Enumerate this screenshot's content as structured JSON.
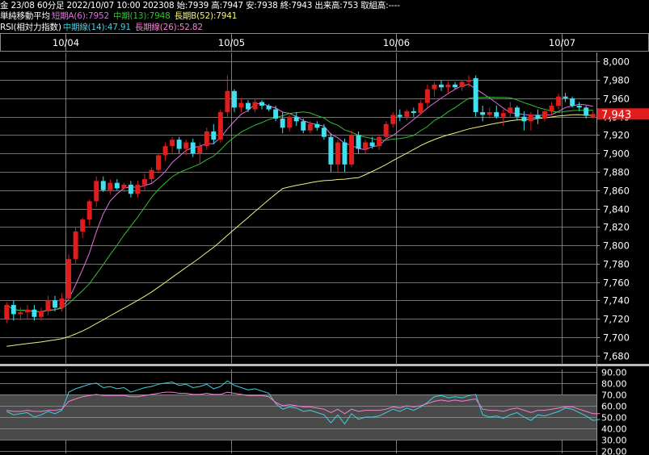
{
  "header": {
    "info": "金 23/08 60分足 2022/10/07 10:00 202308 始:7939 高:7947 安:7938 終:7943 出来高:753 取組高:----",
    "ma_title": "単純移動平均",
    "ma_short": "短期A(6):7952",
    "ma_mid": "中期(13):7948",
    "ma_long": "長期B(52):7941",
    "rsi_title": "RSI(相対力指数)",
    "rsi_mid": "中期線(14):47.91",
    "rsi_long": "長期線(26):52.82"
  },
  "colors": {
    "up": "#e01c1c",
    "down": "#40e0f0",
    "ma_short": "#e070e0",
    "ma_mid": "#30c030",
    "ma_long": "#f0f080",
    "rsi_mid": "#40d0e0",
    "rsi_long": "#f080d0",
    "price_tag": "#e01c1c"
  },
  "chart_data": [
    {
      "type": "candlestick",
      "title": "",
      "x_ticks": [
        "10/04",
        "10/05",
        "10/06",
        "10/07"
      ],
      "y_ticks": [
        "8,000",
        "7,980",
        "7,960",
        "7,940",
        "7,920",
        "7,900",
        "7,880",
        "7,860",
        "7,840",
        "7,820",
        "7,800",
        "7,780",
        "7,760",
        "7,740",
        "7,720",
        "7,700",
        "7,680"
      ],
      "ylim": [
        7670,
        8010
      ],
      "current_price_label": "7,943",
      "current_price": 7943,
      "grid": true,
      "candles": [
        {
          "o": 7720,
          "h": 7738,
          "l": 7715,
          "c": 7735
        },
        {
          "o": 7735,
          "h": 7740,
          "l": 7718,
          "c": 7725
        },
        {
          "o": 7725,
          "h": 7732,
          "l": 7718,
          "c": 7727
        },
        {
          "o": 7727,
          "h": 7735,
          "l": 7720,
          "c": 7730
        },
        {
          "o": 7730,
          "h": 7735,
          "l": 7718,
          "c": 7722
        },
        {
          "o": 7722,
          "h": 7732,
          "l": 7718,
          "c": 7728
        },
        {
          "o": 7728,
          "h": 7745,
          "l": 7724,
          "c": 7740
        },
        {
          "o": 7740,
          "h": 7745,
          "l": 7728,
          "c": 7732
        },
        {
          "o": 7732,
          "h": 7748,
          "l": 7728,
          "c": 7742
        },
        {
          "o": 7742,
          "h": 7790,
          "l": 7738,
          "c": 7785
        },
        {
          "o": 7785,
          "h": 7820,
          "l": 7780,
          "c": 7815
        },
        {
          "o": 7815,
          "h": 7830,
          "l": 7808,
          "c": 7828
        },
        {
          "o": 7828,
          "h": 7850,
          "l": 7822,
          "c": 7848
        },
        {
          "o": 7848,
          "h": 7875,
          "l": 7842,
          "c": 7870
        },
        {
          "o": 7870,
          "h": 7875,
          "l": 7858,
          "c": 7860
        },
        {
          "o": 7860,
          "h": 7872,
          "l": 7855,
          "c": 7868
        },
        {
          "o": 7868,
          "h": 7872,
          "l": 7860,
          "c": 7862
        },
        {
          "o": 7862,
          "h": 7868,
          "l": 7858,
          "c": 7866
        },
        {
          "o": 7866,
          "h": 7870,
          "l": 7852,
          "c": 7856
        },
        {
          "o": 7856,
          "h": 7870,
          "l": 7852,
          "c": 7866
        },
        {
          "o": 7866,
          "h": 7878,
          "l": 7860,
          "c": 7872
        },
        {
          "o": 7872,
          "h": 7885,
          "l": 7868,
          "c": 7882
        },
        {
          "o": 7882,
          "h": 7900,
          "l": 7878,
          "c": 7898
        },
        {
          "o": 7898,
          "h": 7912,
          "l": 7892,
          "c": 7908
        },
        {
          "o": 7908,
          "h": 7918,
          "l": 7900,
          "c": 7915
        },
        {
          "o": 7915,
          "h": 7918,
          "l": 7900,
          "c": 7905
        },
        {
          "o": 7905,
          "h": 7915,
          "l": 7898,
          "c": 7912
        },
        {
          "o": 7912,
          "h": 7916,
          "l": 7896,
          "c": 7900
        },
        {
          "o": 7900,
          "h": 7912,
          "l": 7888,
          "c": 7908
        },
        {
          "o": 7908,
          "h": 7928,
          "l": 7904,
          "c": 7924
        },
        {
          "o": 7924,
          "h": 7932,
          "l": 7910,
          "c": 7915
        },
        {
          "o": 7915,
          "h": 7948,
          "l": 7912,
          "c": 7945
        },
        {
          "o": 7945,
          "h": 7985,
          "l": 7940,
          "c": 7968
        },
        {
          "o": 7968,
          "h": 7970,
          "l": 7945,
          "c": 7950
        },
        {
          "o": 7950,
          "h": 7960,
          "l": 7945,
          "c": 7955
        },
        {
          "o": 7955,
          "h": 7958,
          "l": 7945,
          "c": 7948
        },
        {
          "o": 7948,
          "h": 7960,
          "l": 7945,
          "c": 7956
        },
        {
          "o": 7956,
          "h": 7958,
          "l": 7948,
          "c": 7952
        },
        {
          "o": 7952,
          "h": 7954,
          "l": 7946,
          "c": 7948
        },
        {
          "o": 7948,
          "h": 7952,
          "l": 7935,
          "c": 7938
        },
        {
          "o": 7938,
          "h": 7945,
          "l": 7922,
          "c": 7928
        },
        {
          "o": 7928,
          "h": 7942,
          "l": 7924,
          "c": 7940
        },
        {
          "o": 7940,
          "h": 7945,
          "l": 7930,
          "c": 7935
        },
        {
          "o": 7935,
          "h": 7938,
          "l": 7922,
          "c": 7925
        },
        {
          "o": 7925,
          "h": 7935,
          "l": 7922,
          "c": 7932
        },
        {
          "o": 7932,
          "h": 7935,
          "l": 7925,
          "c": 7928
        },
        {
          "o": 7928,
          "h": 7932,
          "l": 7915,
          "c": 7918
        },
        {
          "o": 7918,
          "h": 7922,
          "l": 7880,
          "c": 7888
        },
        {
          "o": 7888,
          "h": 7915,
          "l": 7880,
          "c": 7912
        },
        {
          "o": 7912,
          "h": 7916,
          "l": 7880,
          "c": 7888
        },
        {
          "o": 7888,
          "h": 7925,
          "l": 7885,
          "c": 7920
        },
        {
          "o": 7920,
          "h": 7924,
          "l": 7900,
          "c": 7905
        },
        {
          "o": 7905,
          "h": 7915,
          "l": 7900,
          "c": 7912
        },
        {
          "o": 7912,
          "h": 7918,
          "l": 7905,
          "c": 7908
        },
        {
          "o": 7908,
          "h": 7920,
          "l": 7904,
          "c": 7918
        },
        {
          "o": 7918,
          "h": 7935,
          "l": 7914,
          "c": 7932
        },
        {
          "o": 7932,
          "h": 7945,
          "l": 7928,
          "c": 7942
        },
        {
          "o": 7942,
          "h": 7948,
          "l": 7935,
          "c": 7940
        },
        {
          "o": 7940,
          "h": 7948,
          "l": 7936,
          "c": 7946
        },
        {
          "o": 7946,
          "h": 7950,
          "l": 7940,
          "c": 7944
        },
        {
          "o": 7944,
          "h": 7958,
          "l": 7942,
          "c": 7955
        },
        {
          "o": 7955,
          "h": 7975,
          "l": 7950,
          "c": 7970
        },
        {
          "o": 7970,
          "h": 7978,
          "l": 7962,
          "c": 7975
        },
        {
          "o": 7975,
          "h": 7980,
          "l": 7968,
          "c": 7972
        },
        {
          "o": 7972,
          "h": 7978,
          "l": 7966,
          "c": 7975
        },
        {
          "o": 7975,
          "h": 7978,
          "l": 7970,
          "c": 7972
        },
        {
          "o": 7972,
          "h": 7980,
          "l": 7968,
          "c": 7978
        },
        {
          "o": 7978,
          "h": 7985,
          "l": 7972,
          "c": 7980
        },
        {
          "o": 7982,
          "h": 7985,
          "l": 7940,
          "c": 7945
        },
        {
          "o": 7945,
          "h": 7952,
          "l": 7935,
          "c": 7942
        },
        {
          "o": 7942,
          "h": 7950,
          "l": 7938,
          "c": 7945
        },
        {
          "o": 7945,
          "h": 7952,
          "l": 7938,
          "c": 7940
        },
        {
          "o": 7940,
          "h": 7948,
          "l": 7930,
          "c": 7944
        },
        {
          "o": 7944,
          "h": 7956,
          "l": 7940,
          "c": 7950
        },
        {
          "o": 7950,
          "h": 7952,
          "l": 7936,
          "c": 7940
        },
        {
          "o": 7940,
          "h": 7946,
          "l": 7925,
          "c": 7935
        },
        {
          "o": 7935,
          "h": 7945,
          "l": 7925,
          "c": 7942
        },
        {
          "o": 7942,
          "h": 7948,
          "l": 7932,
          "c": 7938
        },
        {
          "o": 7938,
          "h": 7948,
          "l": 7935,
          "c": 7946
        },
        {
          "o": 7946,
          "h": 7956,
          "l": 7942,
          "c": 7952
        },
        {
          "o": 7952,
          "h": 7965,
          "l": 7948,
          "c": 7962
        },
        {
          "o": 7962,
          "h": 7966,
          "l": 7956,
          "c": 7960
        },
        {
          "o": 7960,
          "h": 7962,
          "l": 7950,
          "c": 7952
        },
        {
          "o": 7952,
          "h": 7956,
          "l": 7946,
          "c": 7950
        },
        {
          "o": 7950,
          "h": 7952,
          "l": 7938,
          "c": 7941
        },
        {
          "o": 7939,
          "h": 7947,
          "l": 7938,
          "c": 7943
        }
      ],
      "ma": [
        {
          "name": "短期A(6)",
          "period": 6
        },
        {
          "name": "中期(13)",
          "period": 13
        },
        {
          "name": "長期B(52)",
          "period": 52
        }
      ]
    },
    {
      "type": "line",
      "title": "RSI(相対力指数)",
      "y_ticks": [
        "90.00",
        "80.00",
        "70.00",
        "60.00",
        "50.00",
        "40.00",
        "30.00",
        "20.00"
      ],
      "ylim": [
        18,
        92
      ],
      "shaded_band": [
        30,
        70
      ],
      "series": [
        {
          "name": "中期線(14)",
          "values": [
            55,
            52,
            53,
            54,
            50,
            52,
            55,
            53,
            56,
            72,
            75,
            77,
            79,
            80,
            76,
            77,
            75,
            76,
            72,
            74,
            76,
            77,
            79,
            80,
            81,
            78,
            79,
            76,
            77,
            79,
            75,
            77,
            82,
            78,
            76,
            74,
            75,
            73,
            71,
            62,
            57,
            59,
            58,
            55,
            56,
            54,
            52,
            45,
            52,
            44,
            53,
            48,
            50,
            50,
            51,
            54,
            57,
            55,
            58,
            56,
            59,
            63,
            68,
            69,
            67,
            68,
            67,
            69,
            70,
            52,
            50,
            51,
            49,
            52,
            54,
            50,
            47,
            52,
            51,
            53,
            55,
            58,
            57,
            54,
            51,
            47,
            48
          ]
        },
        {
          "name": "長期線(26)",
          "values": [
            56,
            55,
            55,
            56,
            55,
            55,
            56,
            56,
            57,
            64,
            66,
            68,
            69,
            70,
            69,
            69,
            69,
            69,
            68,
            68,
            69,
            70,
            71,
            72,
            72,
            71,
            71,
            70,
            70,
            71,
            70,
            70,
            72,
            71,
            70,
            69,
            69,
            69,
            68,
            63,
            60,
            61,
            60,
            59,
            59,
            58,
            57,
            54,
            57,
            53,
            57,
            55,
            56,
            56,
            56,
            57,
            59,
            58,
            60,
            59,
            60,
            62,
            64,
            65,
            64,
            65,
            64,
            65,
            66,
            57,
            56,
            56,
            55,
            57,
            58,
            56,
            54,
            56,
            56,
            57,
            58,
            59,
            59,
            57,
            55,
            53,
            53
          ]
        }
      ]
    }
  ]
}
